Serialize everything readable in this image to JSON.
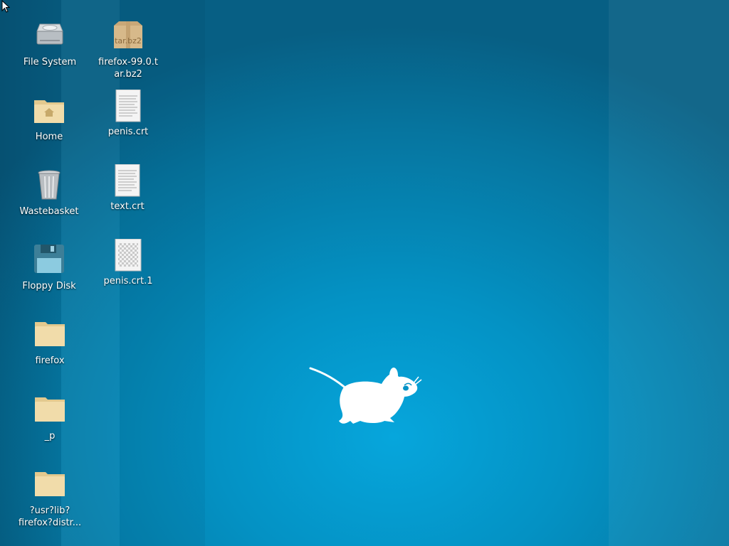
{
  "desktop": {
    "background_color": "#0590c2",
    "icons_col1": [
      {
        "label": "File System",
        "icon": "harddisk-icon"
      },
      {
        "label": "Home",
        "icon": "home-folder-icon"
      },
      {
        "label": "Wastebasket",
        "icon": "trash-icon"
      },
      {
        "label": "Floppy Disk",
        "icon": "floppy-icon"
      },
      {
        "label": "firefox",
        "icon": "folder-icon"
      },
      {
        "label": "_p",
        "icon": "folder-icon"
      },
      {
        "label": "?usr?lib?\nfirefox?distr...",
        "icon": "folder-icon"
      }
    ],
    "icons_col2": [
      {
        "label": "firefox-99.0.t\nar.bz2",
        "icon": "archive-icon",
        "badge": "tar.bz2"
      },
      {
        "label": "penis.crt",
        "icon": "text-file-icon"
      },
      {
        "label": "text.crt",
        "icon": "text-file-icon"
      },
      {
        "label": "penis.crt.1",
        "icon": "image-file-icon"
      }
    ]
  }
}
